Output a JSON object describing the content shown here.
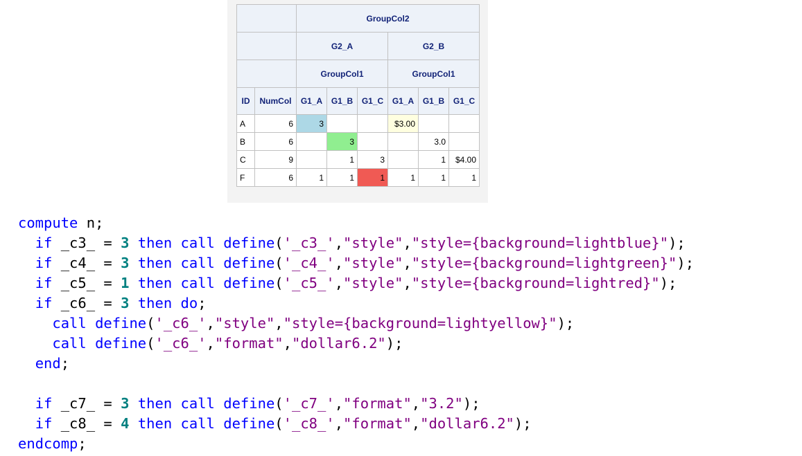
{
  "table": {
    "top_header": "GroupCol2",
    "g2_headers": [
      "G2_A",
      "G2_B"
    ],
    "g1_group_headers": [
      "GroupCol1",
      "GroupCol1"
    ],
    "columns": [
      "ID",
      "NumCol",
      "G1_A",
      "G1_B",
      "G1_C",
      "G1_A",
      "G1_B",
      "G1_C"
    ],
    "rows": [
      [
        "A",
        "6",
        "3",
        "",
        "",
        "$3.00",
        "",
        ""
      ],
      [
        "B",
        "6",
        "",
        "3",
        "",
        "",
        "3.0",
        ""
      ],
      [
        "C",
        "9",
        "",
        "1",
        "3",
        "",
        "1",
        "$4.00"
      ],
      [
        "F",
        "6",
        "1",
        "1",
        "1",
        "1",
        "1",
        "1"
      ]
    ],
    "highlights": [
      {
        "row": 0,
        "col": 2,
        "color": "#add8e6"
      },
      {
        "row": 1,
        "col": 3,
        "color": "#90ee90"
      },
      {
        "row": 3,
        "col": 4,
        "color": "#f05a54"
      },
      {
        "row": 0,
        "col": 5,
        "color": "#ffffe0"
      }
    ]
  },
  "code": {
    "lines": [
      [
        {
          "t": "compute",
          "c": "kw"
        },
        {
          "t": " n;"
        }
      ],
      [
        {
          "t": "  "
        },
        {
          "t": "if",
          "c": "kw"
        },
        {
          "t": " _c3_ = "
        },
        {
          "t": "3",
          "c": "num"
        },
        {
          "t": " "
        },
        {
          "t": "then",
          "c": "kw"
        },
        {
          "t": " "
        },
        {
          "t": "call define",
          "c": "kw"
        },
        {
          "t": "("
        },
        {
          "t": "'_c3_'",
          "c": "str"
        },
        {
          "t": ","
        },
        {
          "t": "\"style\"",
          "c": "str"
        },
        {
          "t": ","
        },
        {
          "t": "\"style={background=lightblue}\"",
          "c": "str"
        },
        {
          "t": ");"
        }
      ],
      [
        {
          "t": "  "
        },
        {
          "t": "if",
          "c": "kw"
        },
        {
          "t": " _c4_ = "
        },
        {
          "t": "3",
          "c": "num"
        },
        {
          "t": " "
        },
        {
          "t": "then",
          "c": "kw"
        },
        {
          "t": " "
        },
        {
          "t": "call define",
          "c": "kw"
        },
        {
          "t": "("
        },
        {
          "t": "'_c4_'",
          "c": "str"
        },
        {
          "t": ","
        },
        {
          "t": "\"style\"",
          "c": "str"
        },
        {
          "t": ","
        },
        {
          "t": "\"style={background=lightgreen}\"",
          "c": "str"
        },
        {
          "t": ");"
        }
      ],
      [
        {
          "t": "  "
        },
        {
          "t": "if",
          "c": "kw"
        },
        {
          "t": " _c5_ = "
        },
        {
          "t": "1",
          "c": "num"
        },
        {
          "t": " "
        },
        {
          "t": "then",
          "c": "kw"
        },
        {
          "t": " "
        },
        {
          "t": "call define",
          "c": "kw"
        },
        {
          "t": "("
        },
        {
          "t": "'_c5_'",
          "c": "str"
        },
        {
          "t": ","
        },
        {
          "t": "\"style\"",
          "c": "str"
        },
        {
          "t": ","
        },
        {
          "t": "\"style={background=lightred}\"",
          "c": "str"
        },
        {
          "t": ");"
        }
      ],
      [
        {
          "t": "  "
        },
        {
          "t": "if",
          "c": "kw"
        },
        {
          "t": " _c6_ = "
        },
        {
          "t": "3",
          "c": "num"
        },
        {
          "t": " "
        },
        {
          "t": "then do",
          "c": "kw"
        },
        {
          "t": ";"
        }
      ],
      [
        {
          "t": "    "
        },
        {
          "t": "call define",
          "c": "kw"
        },
        {
          "t": "("
        },
        {
          "t": "'_c6_'",
          "c": "str"
        },
        {
          "t": ","
        },
        {
          "t": "\"style\"",
          "c": "str"
        },
        {
          "t": ","
        },
        {
          "t": "\"style={background=lightyellow}\"",
          "c": "str"
        },
        {
          "t": ");"
        }
      ],
      [
        {
          "t": "    "
        },
        {
          "t": "call define",
          "c": "kw"
        },
        {
          "t": "("
        },
        {
          "t": "'_c6_'",
          "c": "str"
        },
        {
          "t": ","
        },
        {
          "t": "\"format\"",
          "c": "str"
        },
        {
          "t": ","
        },
        {
          "t": "\"dollar6.2\"",
          "c": "str"
        },
        {
          "t": ");"
        }
      ],
      [
        {
          "t": "  "
        },
        {
          "t": "end",
          "c": "kw"
        },
        {
          "t": ";"
        }
      ],
      [
        {
          "t": ""
        }
      ],
      [
        {
          "t": "  "
        },
        {
          "t": "if",
          "c": "kw"
        },
        {
          "t": " _c7_ = "
        },
        {
          "t": "3",
          "c": "num"
        },
        {
          "t": " "
        },
        {
          "t": "then",
          "c": "kw"
        },
        {
          "t": " "
        },
        {
          "t": "call define",
          "c": "kw"
        },
        {
          "t": "("
        },
        {
          "t": "'_c7_'",
          "c": "str"
        },
        {
          "t": ","
        },
        {
          "t": "\"format\"",
          "c": "str"
        },
        {
          "t": ","
        },
        {
          "t": "\"3.2\"",
          "c": "str"
        },
        {
          "t": ");"
        }
      ],
      [
        {
          "t": "  "
        },
        {
          "t": "if",
          "c": "kw"
        },
        {
          "t": " _c8_ = "
        },
        {
          "t": "4",
          "c": "num"
        },
        {
          "t": " "
        },
        {
          "t": "then",
          "c": "kw"
        },
        {
          "t": " "
        },
        {
          "t": "call define",
          "c": "kw"
        },
        {
          "t": "("
        },
        {
          "t": "'_c8_'",
          "c": "str"
        },
        {
          "t": ","
        },
        {
          "t": "\"format\"",
          "c": "str"
        },
        {
          "t": ","
        },
        {
          "t": "\"dollar6.2\"",
          "c": "str"
        },
        {
          "t": ");"
        }
      ],
      [
        {
          "t": "endcomp",
          "c": "kw"
        },
        {
          "t": ";"
        }
      ]
    ]
  }
}
